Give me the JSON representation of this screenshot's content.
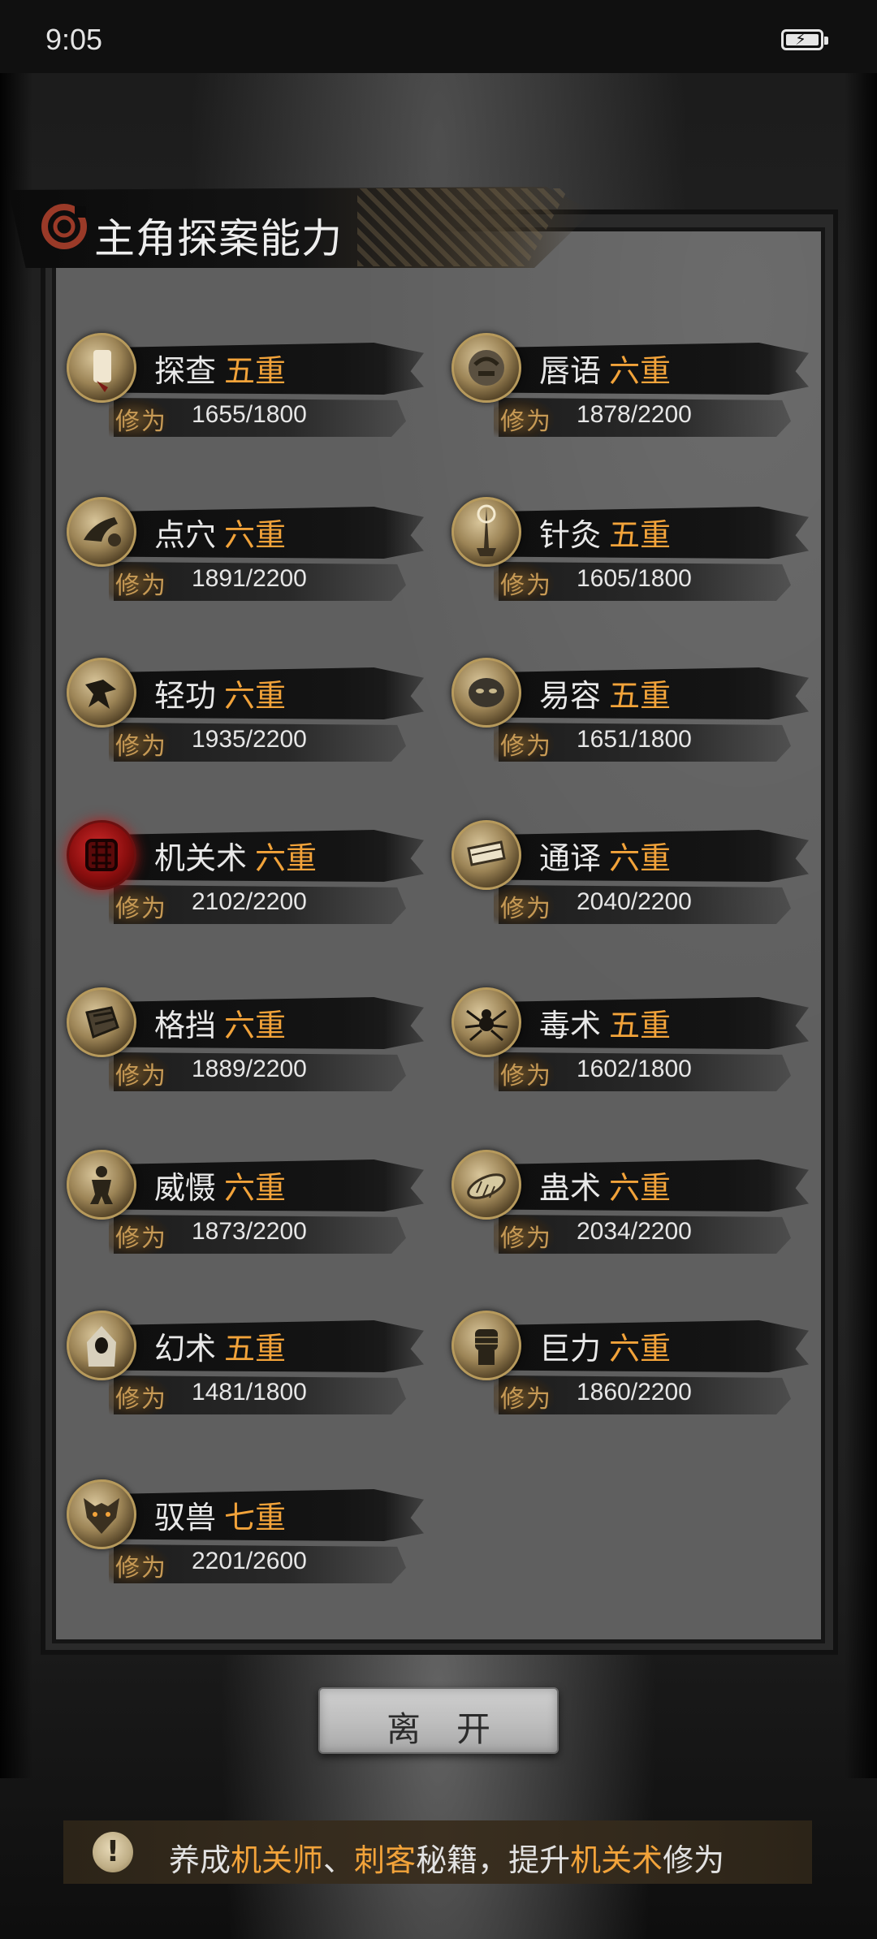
{
  "status": {
    "time": "9:05"
  },
  "header": {
    "title": "主角探案能力"
  },
  "skill_label": "修为",
  "skills": [
    {
      "name": "探查",
      "level": "五重",
      "progress": "1655/1800",
      "icon": "scroll-icon"
    },
    {
      "name": "唇语",
      "level": "六重",
      "progress": "1878/2200",
      "icon": "face-icon"
    },
    {
      "name": "点穴",
      "level": "六重",
      "progress": "1891/2200",
      "icon": "hand-icon"
    },
    {
      "name": "针灸",
      "level": "五重",
      "progress": "1605/1800",
      "icon": "needle-icon"
    },
    {
      "name": "轻功",
      "level": "六重",
      "progress": "1935/2200",
      "icon": "leaping-figure-icon"
    },
    {
      "name": "易容",
      "level": "五重",
      "progress": "1651/1800",
      "icon": "mask-icon"
    },
    {
      "name": "机关术",
      "level": "六重",
      "progress": "2102/2200",
      "icon": "mechanism-icon"
    },
    {
      "name": "通译",
      "level": "六重",
      "progress": "2040/2200",
      "icon": "book-scroll-icon"
    },
    {
      "name": "格挡",
      "level": "六重",
      "progress": "1889/2200",
      "icon": "bracer-icon"
    },
    {
      "name": "毒术",
      "level": "五重",
      "progress": "1602/1800",
      "icon": "spider-icon"
    },
    {
      "name": "威慑",
      "level": "六重",
      "progress": "1873/2200",
      "icon": "warrior-icon"
    },
    {
      "name": "蛊术",
      "level": "六重",
      "progress": "2034/2200",
      "icon": "larva-icon"
    },
    {
      "name": "幻术",
      "level": "五重",
      "progress": "1481/1800",
      "icon": "hooded-figure-icon"
    },
    {
      "name": "巨力",
      "level": "六重",
      "progress": "1860/2200",
      "icon": "fist-icon"
    },
    {
      "name": "驭兽",
      "level": "七重",
      "progress": "2201/2600",
      "icon": "wolf-icon"
    }
  ],
  "leave_button": {
    "label": "离开"
  },
  "tip": {
    "segments": [
      {
        "text": "养成",
        "highlight": false
      },
      {
        "text": "机关师",
        "highlight": true
      },
      {
        "text": "、",
        "highlight": false
      },
      {
        "text": "刺客",
        "highlight": true
      },
      {
        "text": "秘籍，提升",
        "highlight": false
      },
      {
        "text": "机关术",
        "highlight": true
      },
      {
        "text": "修为",
        "highlight": false
      }
    ]
  },
  "colors": {
    "accent": "#f2a33a",
    "label": "#c79a55",
    "panel": "#5f5f5f"
  }
}
